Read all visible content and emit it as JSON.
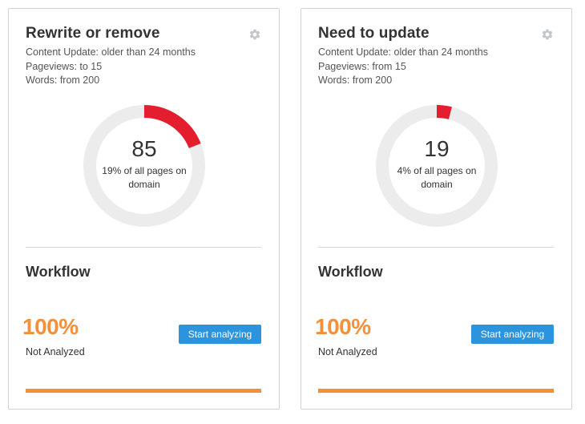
{
  "colors": {
    "accent_red": "#e31e2e",
    "track_gray": "#ececec",
    "accent_orange": "#f4903b",
    "button_blue": "#2c94de"
  },
  "cards": [
    {
      "title": "Rewrite or remove",
      "criteria": [
        "Content Update: older than 24 months",
        "Pageviews: to 15",
        "Words: from 200"
      ],
      "donut": {
        "count": "85",
        "caption": "19% of all pages on domain",
        "fraction": 0.19
      },
      "workflow": {
        "title": "Workflow",
        "percent": "100%",
        "status": "Not Analyzed",
        "button_label": "Start analyzing",
        "progress": 1.0
      }
    },
    {
      "title": "Need to update",
      "criteria": [
        "Content Update: older than 24 months",
        "Pageviews: from 15",
        "Words: from 200"
      ],
      "donut": {
        "count": "19",
        "caption": "4% of all pages on domain",
        "fraction": 0.04
      },
      "workflow": {
        "title": "Workflow",
        "percent": "100%",
        "status": "Not Analyzed",
        "button_label": "Start analyzing",
        "progress": 1.0
      }
    }
  ]
}
